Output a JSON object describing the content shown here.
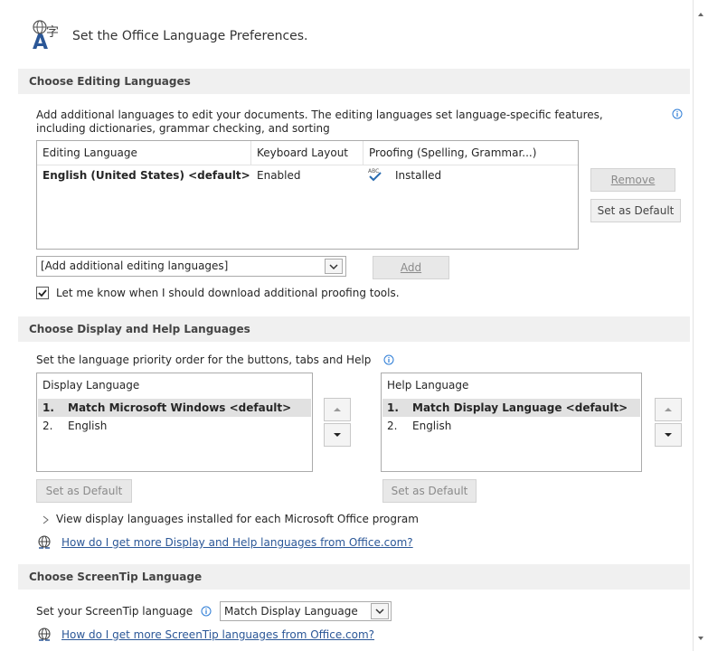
{
  "header": {
    "title": "Set the Office Language Preferences."
  },
  "editing": {
    "section_title": "Choose Editing Languages",
    "description": "Add additional languages to edit your documents. The editing languages set language-specific features, including dictionaries, grammar checking, and sorting",
    "table": {
      "headers": [
        "Editing Language",
        "Keyboard Layout",
        "Proofing (Spelling, Grammar...)"
      ],
      "rows": [
        {
          "language": "English (United States) <default>",
          "keyboard": "Enabled",
          "proofing": "Installed"
        }
      ]
    },
    "remove_label": "Remove",
    "set_default_label": "Set as Default",
    "add_dropdown_value": "[Add additional editing languages]",
    "add_label": "Add",
    "checkbox_label": "Let me know when I should download additional proofing tools.",
    "checkbox_checked": true
  },
  "display": {
    "section_title": "Choose Display and Help Languages",
    "description": "Set the language priority order for the buttons, tabs and Help",
    "display_list": {
      "header": "Display Language",
      "items": [
        {
          "num": "1.",
          "label": "Match Microsoft Windows <default>"
        },
        {
          "num": "2.",
          "label": "English"
        }
      ]
    },
    "help_list": {
      "header": "Help Language",
      "items": [
        {
          "num": "1.",
          "label": "Match Display Language <default>"
        },
        {
          "num": "2.",
          "label": "English"
        }
      ]
    },
    "set_default_label": "Set as Default",
    "view_installed_label": "View display languages installed for each Microsoft Office program",
    "more_link": "How do I get more Display and Help languages from Office.com?"
  },
  "screentip": {
    "section_title": "Choose ScreenTip Language",
    "label": "Set your ScreenTip language",
    "dropdown_value": "Match Display Language",
    "more_link": "How do I get more ScreenTip languages from Office.com?"
  }
}
